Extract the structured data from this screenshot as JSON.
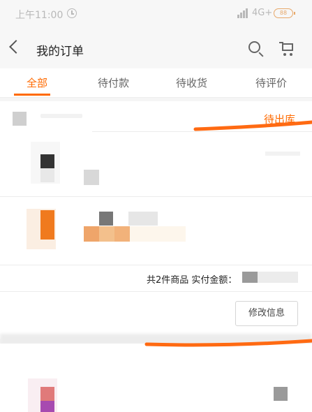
{
  "status_bar": {
    "time": "上午11:00",
    "network": "4G+",
    "battery": "88"
  },
  "header": {
    "title": "我的订单"
  },
  "tabs": [
    {
      "label": "全部",
      "active": true
    },
    {
      "label": "待付款",
      "active": false
    },
    {
      "label": "待收货",
      "active": false
    },
    {
      "label": "待评价",
      "active": false
    }
  ],
  "order": {
    "status": "待出库",
    "summary": "共2件商品  实付金额：",
    "edit_button": "修改信息"
  },
  "colors": {
    "accent": "#ff6a00",
    "annotation": "#ff6a12"
  }
}
